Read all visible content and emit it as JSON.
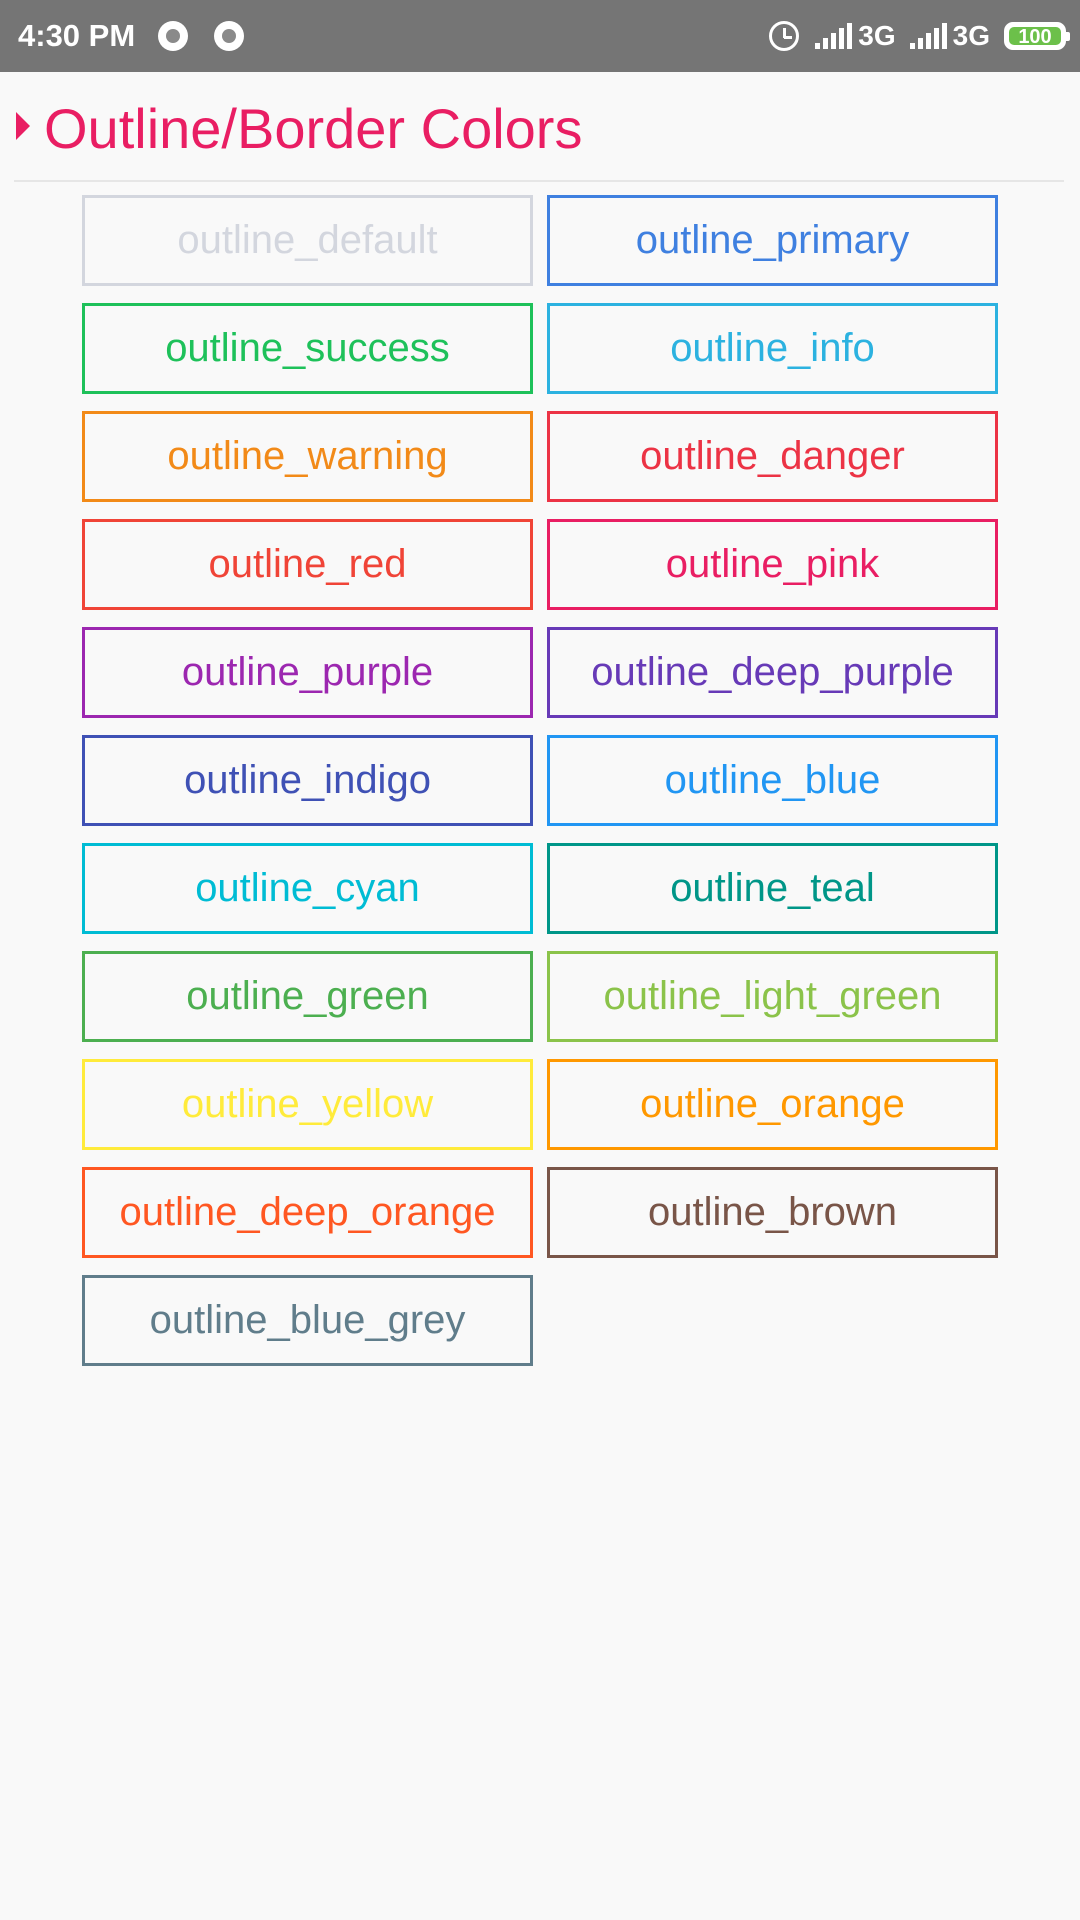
{
  "status_bar": {
    "time": "4:30 PM",
    "network1": "3G",
    "network2": "3G",
    "battery": "100",
    "icons": [
      "notification-dot-icon",
      "notification-dot-icon",
      "alarm-icon",
      "signal-icon",
      "signal-icon",
      "battery-icon"
    ]
  },
  "section": {
    "title": "Outline/Border Colors",
    "accent_color": "#e91e63"
  },
  "buttons": [
    {
      "label": "outline_default",
      "color": "#d3d6de"
    },
    {
      "label": "outline_primary",
      "color": "#3f80e0"
    },
    {
      "label": "outline_success",
      "color": "#1ec15a"
    },
    {
      "label": "outline_info",
      "color": "#2cb2e0"
    },
    {
      "label": "outline_warning",
      "color": "#f28a18"
    },
    {
      "label": "outline_danger",
      "color": "#ec3345"
    },
    {
      "label": "outline_red",
      "color": "#f04437"
    },
    {
      "label": "outline_pink",
      "color": "#e91e63"
    },
    {
      "label": "outline_purple",
      "color": "#9c27b0"
    },
    {
      "label": "outline_deep_purple",
      "color": "#673ab7"
    },
    {
      "label": "outline_indigo",
      "color": "#3f51b5"
    },
    {
      "label": "outline_blue",
      "color": "#2196f3"
    },
    {
      "label": "outline_cyan",
      "color": "#00bcd4"
    },
    {
      "label": "outline_teal",
      "color": "#009688"
    },
    {
      "label": "outline_green",
      "color": "#4caf50"
    },
    {
      "label": "outline_light_green",
      "color": "#8bc34a"
    },
    {
      "label": "outline_yellow",
      "color": "#ffeb3b"
    },
    {
      "label": "outline_orange",
      "color": "#ff9800"
    },
    {
      "label": "outline_deep_orange",
      "color": "#ff5722"
    },
    {
      "label": "outline_brown",
      "color": "#795548"
    },
    {
      "label": "outline_blue_grey",
      "color": "#607d8b"
    }
  ]
}
